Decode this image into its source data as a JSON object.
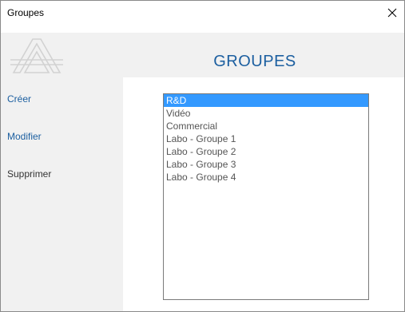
{
  "window": {
    "title": "Groupes",
    "close_icon": "close-icon"
  },
  "header": {
    "logo_icon": "logo-a-icon",
    "title": "GROUPES"
  },
  "sidebar": {
    "items": [
      {
        "label": "Créer"
      },
      {
        "label": "Modifier"
      },
      {
        "label": "Supprimer"
      }
    ]
  },
  "groups_list": {
    "items": [
      {
        "label": "R&D",
        "selected": true
      },
      {
        "label": "Vidéo",
        "selected": false
      },
      {
        "label": "Commercial",
        "selected": false
      },
      {
        "label": "Labo - Groupe 1",
        "selected": false
      },
      {
        "label": "Labo - Groupe 2",
        "selected": false
      },
      {
        "label": "Labo - Groupe 3",
        "selected": false
      },
      {
        "label": "Labo - Groupe 4",
        "selected": false
      }
    ]
  },
  "colors": {
    "accent": "#1c5fa0",
    "selection": "#3399ff",
    "content_bg": "#f1f1f1"
  }
}
